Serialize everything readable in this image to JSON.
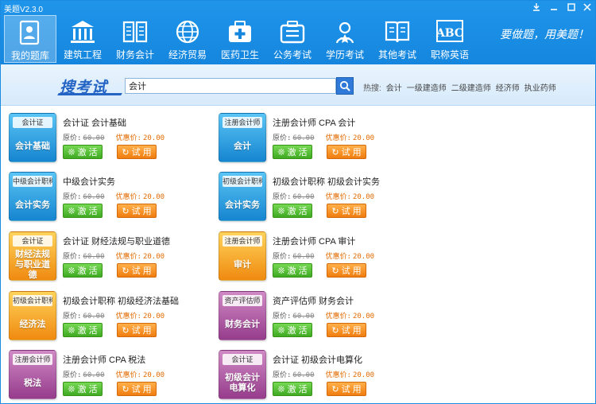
{
  "window": {
    "title": "美题V2.3.0"
  },
  "nav": {
    "items": [
      {
        "label": "我的题库",
        "icon": "user-card-icon"
      },
      {
        "label": "建筑工程",
        "icon": "building-icon"
      },
      {
        "label": "财务会计",
        "icon": "ledger-icon"
      },
      {
        "label": "经济贸易",
        "icon": "globe-icon"
      },
      {
        "label": "医药卫生",
        "icon": "medkit-icon"
      },
      {
        "label": "公务考试",
        "icon": "briefcase-icon"
      },
      {
        "label": "学历考试",
        "icon": "graduate-icon"
      },
      {
        "label": "其他考试",
        "icon": "book-icon"
      },
      {
        "label": "职称英语",
        "icon": "abc-icon"
      }
    ],
    "slogan": "要做题，用美题！"
  },
  "search": {
    "logo": "搜考试",
    "value": "会计",
    "hot_label": "热搜:",
    "hot_keywords": [
      "会计",
      "一级建造师",
      "二级建造师",
      "经济师",
      "执业药师"
    ]
  },
  "labels": {
    "orig": "原价:",
    "sale": "优惠价:",
    "activate": "激 活",
    "trial": "试 用"
  },
  "colors": {
    "header_blue": "#1586de",
    "green_button": "#3faa22",
    "orange_button": "#f07d10",
    "sale_price": "#e36a00"
  },
  "cards": [
    {
      "tag": "会计证",
      "subject": "会计基础",
      "title": "会计证 会计基础",
      "orig": "60.00",
      "sale": "20.00",
      "theme": "blue"
    },
    {
      "tag": "注册会计师",
      "subject": "会计",
      "title": "注册会计师 CPA 会计",
      "orig": "60.00",
      "sale": "20.00",
      "theme": "blue"
    },
    {
      "tag": "中级会计职称",
      "subject": "会计实务",
      "title": "中级会计实务",
      "orig": "60.00",
      "sale": "20.00",
      "theme": "blue"
    },
    {
      "tag": "初级会计职称",
      "subject": "会计实务",
      "title": "初级会计职称 初级会计实务",
      "orig": "60.00",
      "sale": "20.00",
      "theme": "blue"
    },
    {
      "tag": "会计证",
      "subject": "财经法规与职业道德",
      "title": "会计证 财经法规与职业道德",
      "orig": "60.00",
      "sale": "20.00",
      "theme": "orange"
    },
    {
      "tag": "注册会计师",
      "subject": "审计",
      "title": "注册会计师 CPA 审计",
      "orig": "60.00",
      "sale": "20.00",
      "theme": "orange"
    },
    {
      "tag": "初级会计职称",
      "subject": "经济法",
      "title": "初级会计职称 初级经济法基础",
      "orig": "60.00",
      "sale": "20.00",
      "theme": "orange"
    },
    {
      "tag": "资产评估师",
      "subject": "财务会计",
      "title": "资产评估师 财务会计",
      "orig": "60.00",
      "sale": "20.00",
      "theme": "purple"
    },
    {
      "tag": "注册会计师",
      "subject": "税法",
      "title": "注册会计师 CPA 税法",
      "orig": "60.00",
      "sale": "20.00",
      "theme": "purple"
    },
    {
      "tag": "会计证",
      "subject": "初级会计电算化",
      "title": "会计证 初级会计电算化",
      "orig": "60.00",
      "sale": "20.00",
      "theme": "purple"
    }
  ]
}
